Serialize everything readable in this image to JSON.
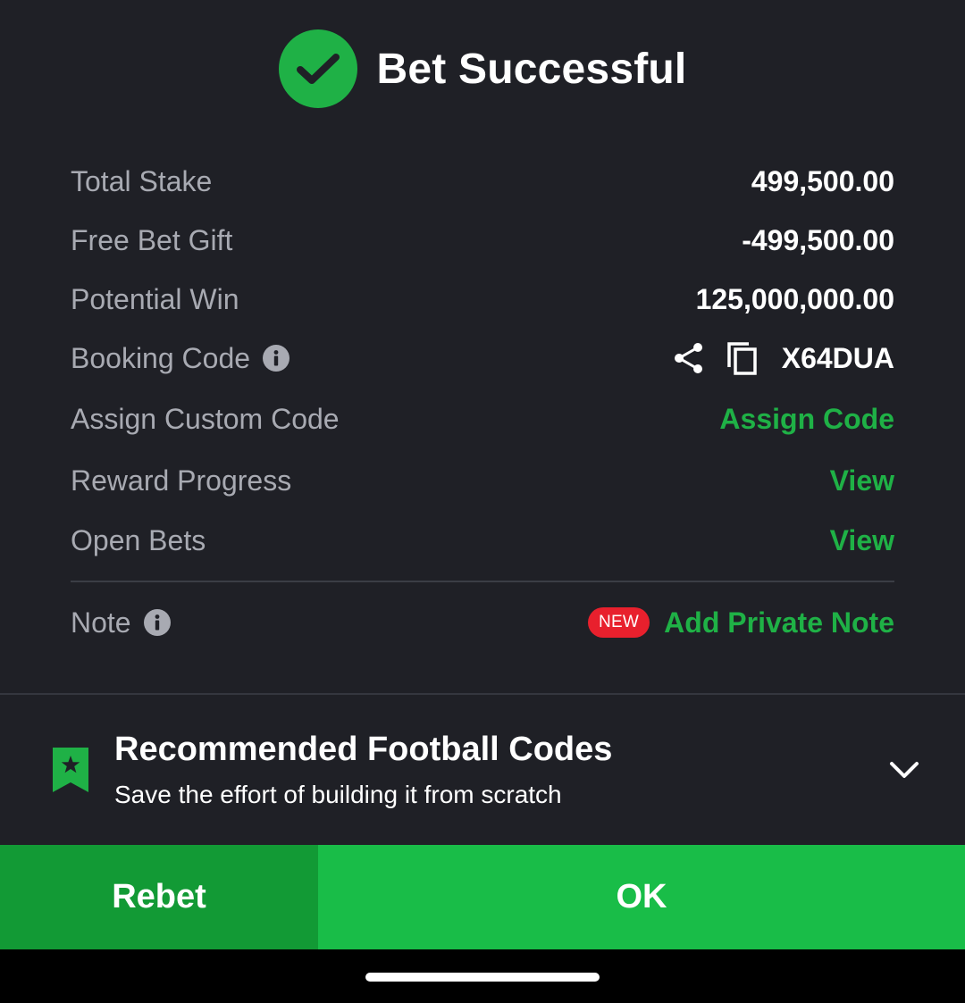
{
  "header": {
    "title": "Bet Successful",
    "icon": "check-circle-icon",
    "accent_color": "#1fb146"
  },
  "summary": {
    "total_stake": {
      "label": "Total Stake",
      "value": "499,500.00"
    },
    "free_bet_gift": {
      "label": "Free Bet Gift",
      "value": "-499,500.00"
    },
    "potential_win": {
      "label": "Potential Win",
      "value": "125,000,000.00"
    },
    "booking_code": {
      "label": "Booking Code",
      "value": "X64DUA",
      "icons": [
        "info-icon",
        "share-icon",
        "copy-icon"
      ]
    },
    "assign_custom_code": {
      "label": "Assign Custom Code",
      "link": "Assign Code"
    },
    "reward_progress": {
      "label": "Reward Progress",
      "link": "View"
    },
    "open_bets": {
      "label": "Open Bets",
      "link": "View"
    },
    "note": {
      "label": "Note",
      "badge": "NEW",
      "link": "Add Private Note",
      "badge_color": "#e8202d"
    }
  },
  "recommended": {
    "title": "Recommended Football Codes",
    "subtitle": "Save the effort of building it from scratch",
    "icons": [
      "bookmark-star-icon",
      "chevron-down-icon"
    ]
  },
  "buttons": {
    "rebet": "Rebet",
    "ok": "OK",
    "rebet_color": "#129a35",
    "ok_color": "#19bd48"
  }
}
